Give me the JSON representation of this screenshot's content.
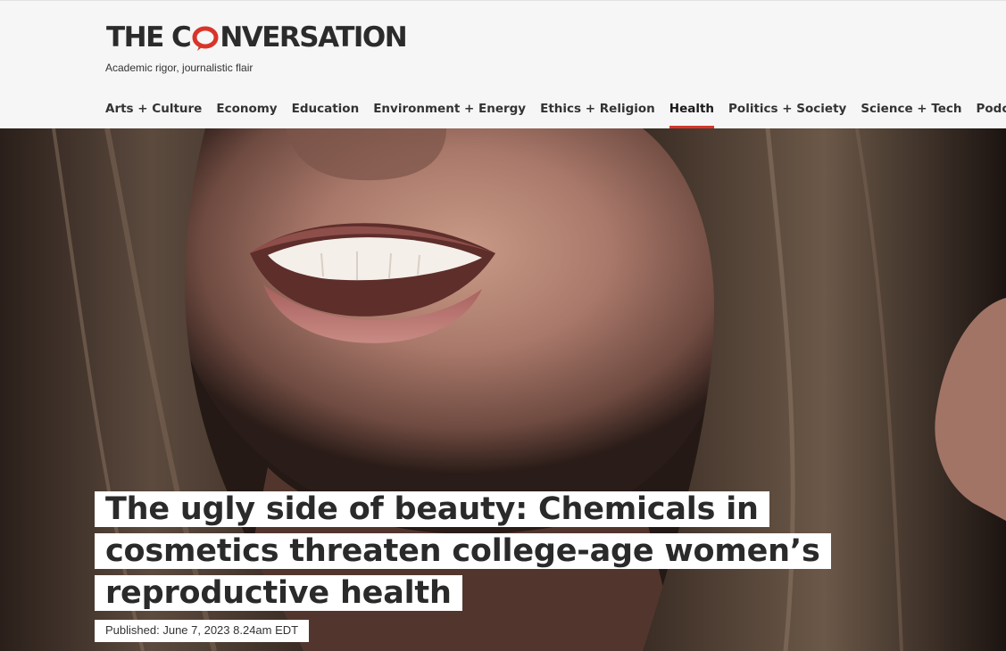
{
  "site": {
    "logo_text_before": "THE C",
    "logo_text_after": "NVERSATION",
    "logo_icon": "speech-bubble-o-icon",
    "tagline": "Academic rigor, journalistic flair",
    "accent_color": "#d8352a"
  },
  "nav": {
    "items": [
      {
        "label": "Arts + Culture"
      },
      {
        "label": "Economy"
      },
      {
        "label": "Education"
      },
      {
        "label": "Environment + Energy"
      },
      {
        "label": "Ethics + Religion"
      },
      {
        "label": "Health",
        "active": true
      },
      {
        "label": "Politics + Society"
      },
      {
        "label": "Science + Tech"
      },
      {
        "label": "Podcasts"
      }
    ]
  },
  "article": {
    "title": "The ugly side of beauty: Chemicals in cosmetics threaten college-age women’s reproductive health",
    "published_label": "Published:",
    "published_date": "June 7, 2023 8.24am EDT"
  }
}
